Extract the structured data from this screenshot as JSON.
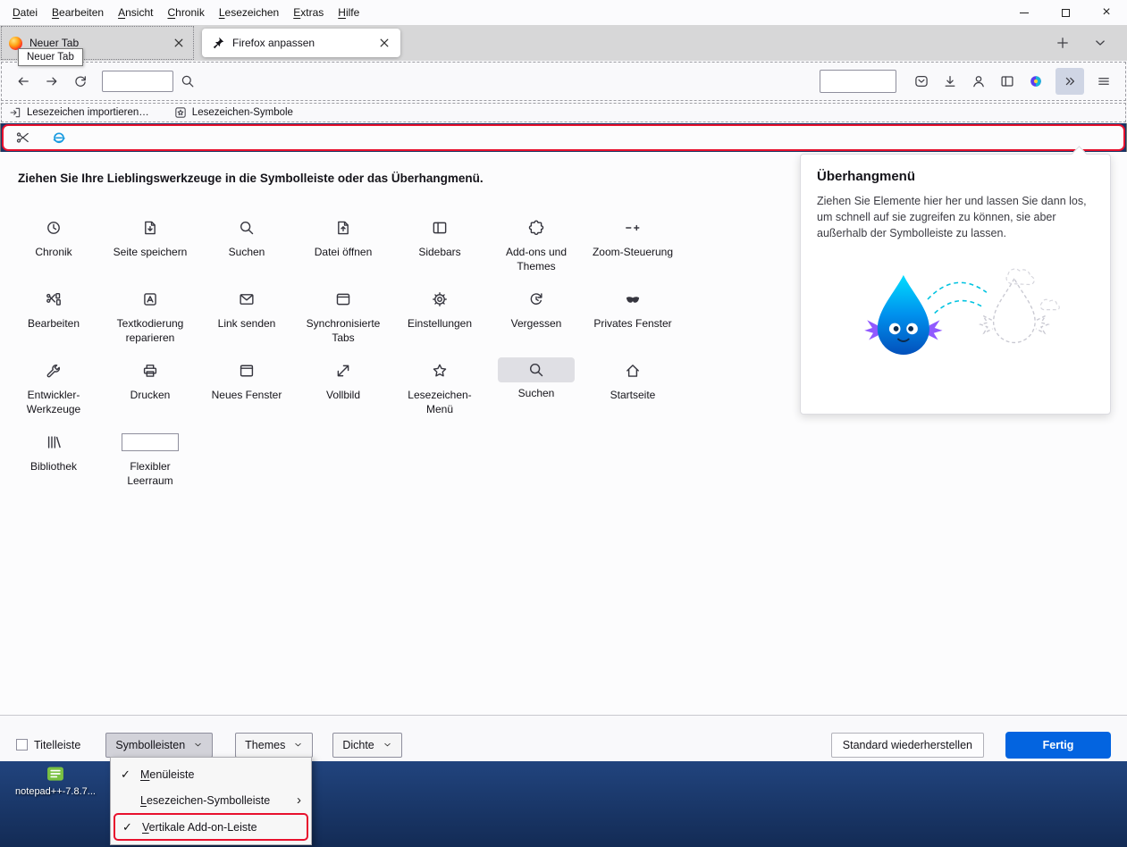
{
  "menubar": {
    "items": [
      {
        "label": "Datei"
      },
      {
        "label": "Bearbeiten"
      },
      {
        "label": "Ansicht"
      },
      {
        "label": "Chronik"
      },
      {
        "label": "Lesezeichen"
      },
      {
        "label": "Extras"
      },
      {
        "label": "Hilfe"
      }
    ]
  },
  "tabs": {
    "tab1": {
      "label": "Neuer Tab",
      "favicon": "firefox-icon"
    },
    "tab2": {
      "label": "Firefox anpassen",
      "icon": "pin-icon"
    }
  },
  "tab_actions": {
    "buttons": [
      {
        "name": "new-tab-button",
        "icon": "plus-icon"
      },
      {
        "name": "tab-list-button",
        "icon": "chevron-down-icon"
      }
    ]
  },
  "tooltip": {
    "text": "Neuer Tab"
  },
  "icons": {
    "close": "close-icon",
    "caret": "caret-icon"
  },
  "navbar": {
    "left_buttons": [
      {
        "name": "back-button",
        "icon": "back-icon"
      },
      {
        "name": "forward-button",
        "icon": "forward-icon"
      },
      {
        "name": "reload-button",
        "icon": "reload-icon"
      }
    ],
    "url_field_value": "",
    "search_button_icon": "search-icon",
    "search_field_value": "",
    "right_buttons": [
      {
        "name": "pocket-button",
        "icon": "pocket-icon"
      },
      {
        "name": "downloads-button",
        "icon": "download-icon"
      },
      {
        "name": "account-button",
        "icon": "account-icon"
      },
      {
        "name": "sidebar-button",
        "icon": "sidebar-icon"
      },
      {
        "name": "extension-button",
        "icon": "extension-colored-icon"
      }
    ],
    "overflow_button_icon": "chevron-double-right-icon",
    "menu_button_icon": "hamburger-icon"
  },
  "bookmarks_bar": {
    "items": [
      {
        "name": "import-bookmarks-item",
        "icon": "import-bookmarks-icon",
        "label": "Lesezeichen importieren…"
      },
      {
        "name": "bookmark-symbols-item",
        "icon": "bookmark-star-box-icon",
        "label": "Lesezeichen-Symbole"
      }
    ]
  },
  "addon_bar": {
    "buttons": [
      {
        "name": "addon-scissors-button",
        "icon": "scissors-tool-icon"
      },
      {
        "name": "ie-tab-button",
        "icon": "ie-logo-icon"
      }
    ]
  },
  "customize": {
    "instruction": "Ziehen Sie Ihre Lieblingswerkzeuge in die Symbolleiste oder das Überhangmenü.",
    "tools": [
      {
        "label": "Chronik",
        "icon": "history-clock-icon"
      },
      {
        "label": "Seite speichern",
        "icon": "save-page-icon"
      },
      {
        "label": "Suchen",
        "icon": "search-icon"
      },
      {
        "label": "Datei öffnen",
        "icon": "open-file-icon"
      },
      {
        "label": "Sidebars",
        "icon": "sidebars-icon"
      },
      {
        "label": "Add-ons und Themes",
        "icon": "addons-icon"
      },
      {
        "label": "Zoom-Steuerung",
        "icon": "zoom-controls-icon"
      },
      {
        "label": "Bearbeiten",
        "icon": "edit-tools-icon"
      },
      {
        "label": "Textkodierung reparieren",
        "icon": "text-encoding-icon"
      },
      {
        "label": "Link senden",
        "icon": "send-link-icon"
      },
      {
        "label": "Synchronisierte Tabs",
        "icon": "synced-tabs-icon"
      },
      {
        "label": "Einstellungen",
        "icon": "settings-gear-icon"
      },
      {
        "label": "Vergessen",
        "icon": "forget-clock-icon"
      },
      {
        "label": "Privates Fenster",
        "icon": "private-mask-icon"
      },
      {
        "label": "Entwickler-Werkzeuge",
        "icon": "devtools-wrench-icon"
      },
      {
        "label": "Drucken",
        "icon": "print-icon"
      },
      {
        "label": "Neues Fenster",
        "icon": "new-window-icon"
      },
      {
        "label": "Vollbild",
        "icon": "fullscreen-icon"
      },
      {
        "label": "Lesezeichen-Menü",
        "icon": "bookmarks-star-icon"
      },
      {
        "label": "Suchen",
        "icon": "search-icon",
        "placed": true
      },
      {
        "label": "Startseite",
        "icon": "home-icon"
      },
      {
        "label": "Bibliothek",
        "icon": "library-icon"
      },
      {
        "label": "Flexibler Leerraum",
        "icon": "flex-space-icon"
      }
    ]
  },
  "overflow_panel": {
    "title": "Überhangmenü",
    "description": "Ziehen Sie Elemente hier her und lassen Sie dann los, um schnell auf sie zugreifen zu können, sie aber außerhalb der Symbolleiste zu lassen."
  },
  "footer": {
    "titlebar_checkbox_label": "Titelleiste",
    "toolbars_dropdown_label": "Symbolleisten",
    "themes_dropdown_label": "Themes",
    "density_dropdown_label": "Dichte",
    "restore_defaults_label": "Standard wiederherstellen",
    "done_label": "Fertig"
  },
  "toolbars_menu": {
    "items": [
      {
        "label": "Menüleiste",
        "checked": true
      },
      {
        "label": "Lesezeichen-Symbolleiste",
        "submenu": true
      },
      {
        "label": "Vertikale Add-on-Leiste",
        "checked": true,
        "highlighted": true
      }
    ]
  },
  "desktop": {
    "icon": "notepadpp-icon",
    "icon_label": "notepad++-7.8.7..."
  }
}
